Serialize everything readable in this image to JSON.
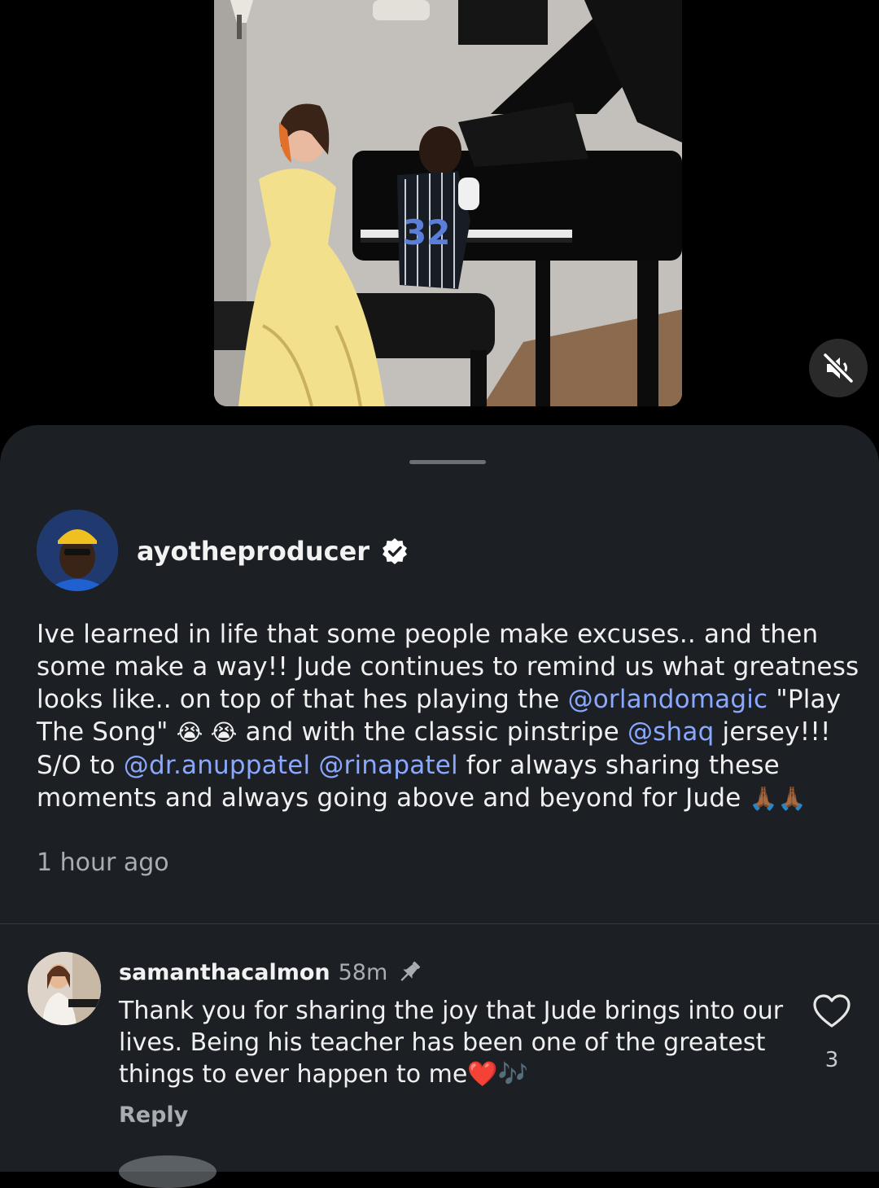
{
  "post": {
    "username": "ayotheproducer",
    "caption_segments": [
      {
        "text": "Ive learned in life that some people make excuses.. and then some make a way!! Jude continues to remind us what greatness looks like.. on top of that hes playing the ",
        "type": "text"
      },
      {
        "text": "@orlandomagic",
        "type": "mention"
      },
      {
        "text": " \"Play The Song\" ",
        "type": "text"
      },
      {
        "text": "😭 😭",
        "type": "emoji"
      },
      {
        "text": " and with the classic pinstripe ",
        "type": "text"
      },
      {
        "text": "@shaq",
        "type": "mention"
      },
      {
        "text": " jersey!!! S/O to ",
        "type": "text"
      },
      {
        "text": "@dr.anuppatel",
        "type": "mention"
      },
      {
        "text": " ",
        "type": "text"
      },
      {
        "text": "@rinapatel",
        "type": "mention"
      },
      {
        "text": " for always sharing these moments and always going above and beyond for Jude ",
        "type": "text"
      },
      {
        "text": "🙏🏾🙏🏾",
        "type": "emoji"
      }
    ],
    "time": "1 hour ago"
  },
  "comment": {
    "username": "samanthacalmon",
    "time": "58m",
    "text": "Thank you for sharing the joy that Jude brings into our lives. Being his teacher has been one of the greatest things to ever happen to me❤️🎶",
    "reply_label": "Reply",
    "like_count": "3"
  },
  "icons": {
    "verified": "verified-badge-icon",
    "pin": "pin-icon",
    "mute": "speaker-muted-icon",
    "heart": "heart-outline-icon"
  },
  "colors": {
    "sheet_bg": "#1c2024",
    "mention": "#8aa8ff",
    "secondary_text": "#a8adb2"
  }
}
